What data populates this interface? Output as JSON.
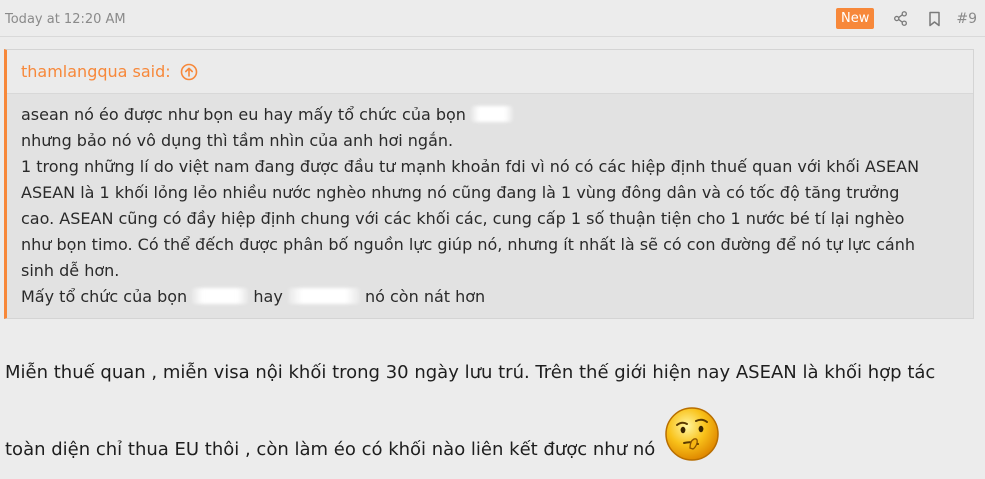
{
  "post": {
    "timestamp": "Today at 12:20 AM",
    "badge": "New",
    "number": "#9",
    "icons": {
      "share": "share-icon",
      "bookmark": "bookmark-icon"
    }
  },
  "quote": {
    "author_said": "thamlangqua said:",
    "jump_icon": "arrow-up-circle-icon",
    "lines": [
      "asean nó éo được như bọn eu hay mấy tổ chức của bọn",
      "nhưng bảo nó vô dụng thì tầm nhìn của anh hơi ngắn.",
      "1 trong những lí do việt nam đang được đầu tư mạnh khoản fdi vì nó có các hiệp định thuế quan với khối ASEAN",
      "ASEAN là 1 khối lỏng lẻo nhiều nước nghèo nhưng nó cũng đang là 1 vùng đông dân và có tốc độ tăng trưởng",
      "cao. ASEAN cũng có đầy hiệp định chung với các khối các, cung cấp 1 số thuận tiện cho 1 nước bé tí lại nghèo",
      "như bọn timo. Có thể đếch được phân bố nguồn lực giúp nó, nhưng ít nhất là sẽ có con đường để nó tự lực cánh",
      "sinh dễ hơn."
    ],
    "last_line": {
      "part1": "Mấy tổ chức của bọn",
      "part2": "hay",
      "part3": "nó còn nát hơn"
    }
  },
  "reply": {
    "line1": "Miễn thuế quan , miễn visa nội khối trong 30 ngày lưu trú. Trên thế giới hiện nay ASEAN là khối hợp tác",
    "line2": "toàn diện chỉ thua EU thôi , còn làm éo có khối nào liên kết được như nó",
    "emoji": "thinking-smiley-icon"
  },
  "colors": {
    "accent": "#f7883a",
    "background": "#ececec",
    "quote_bg": "#e2e2e2"
  }
}
